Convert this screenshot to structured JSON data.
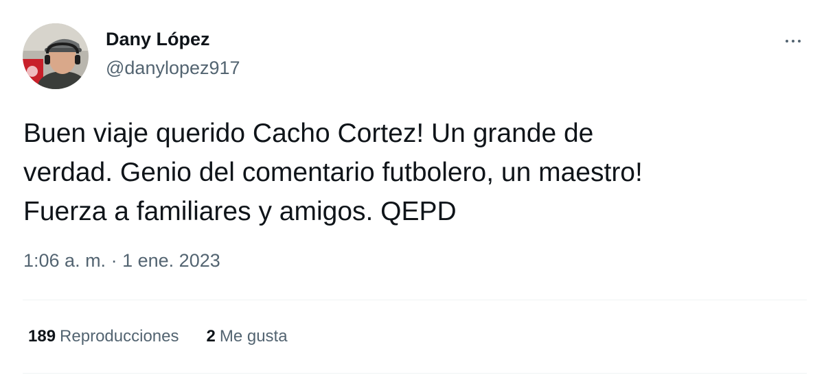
{
  "author": {
    "display_name": "Dany López",
    "handle": "@danylopez917",
    "avatar_icon": "user-photo-avatar"
  },
  "more_icon": "more-horizontal-icon",
  "tweet": {
    "lines": [
      "Buen viaje querido Cacho Cortez! Un grande de",
      "verdad. Genio del comentario futbolero, un maestro!",
      "Fuerza a familiares y amigos. QEPD"
    ],
    "time": "1:06 a. m.",
    "separator": "·",
    "date": "1 ene. 2023"
  },
  "stats": {
    "views": {
      "count": "189",
      "label": "Reproducciones"
    },
    "likes": {
      "count": "2",
      "label": "Me gusta"
    }
  },
  "colors": {
    "text_primary": "#0f1419",
    "text_secondary": "#536471",
    "divider": "#eff3f4",
    "background": "#ffffff"
  }
}
